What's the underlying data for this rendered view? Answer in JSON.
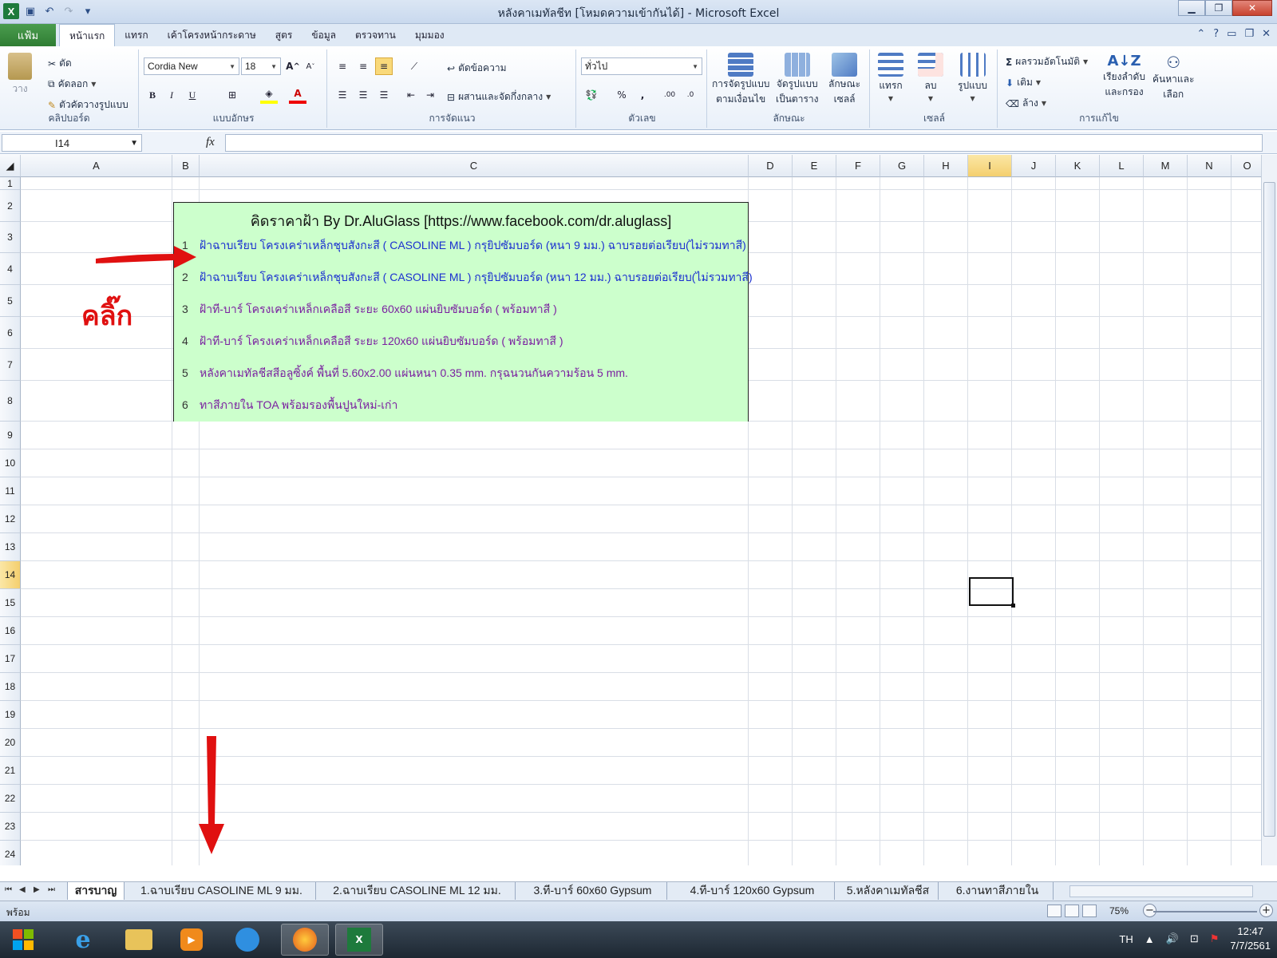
{
  "window": {
    "title": "หลังคาเมทัลชีท  [โหมดความเข้ากันได้] - Microsoft Excel"
  },
  "ribbon_tabs": {
    "file": "แฟ้ม",
    "tabs": [
      "หน้าแรก",
      "แทรก",
      "เค้าโครงหน้ากระดาษ",
      "สูตร",
      "ข้อมูล",
      "ตรวจทาน",
      "มุมมอง"
    ],
    "active": "หน้าแรก"
  },
  "ribbon": {
    "clipboard": {
      "paste": "วาง",
      "cut": "ตัด",
      "copy": "คัดลอก",
      "format_painter": "ตัวคัดวางรูปแบบ",
      "label": "คลิปบอร์ด"
    },
    "font": {
      "name": "Cordia New",
      "size": "18",
      "bold": "B",
      "italic": "I",
      "underline": "U",
      "label": "แบบอักษร"
    },
    "alignment": {
      "wrap": "ตัดข้อความ",
      "merge": "ผสานและจัดกึ่งกลาง",
      "label": "การจัดแนว"
    },
    "number": {
      "format": "ทั่วไป",
      "percent": "%",
      "comma": ",",
      "label": "ตัวเลข"
    },
    "styles": {
      "conditional": [
        "การจัดรูปแบบ",
        "ตามเงื่อนไข"
      ],
      "table": [
        "จัดรูปแบบ",
        "เป็นตาราง"
      ],
      "cell": [
        "ลักษณะ",
        "เซลล์"
      ],
      "label": "ลักษณะ"
    },
    "cells": {
      "insert": "แทรก",
      "delete": "ลบ",
      "format": "รูปแบบ",
      "label": "เซลล์"
    },
    "editing": {
      "autosum": "ผลรวมอัตโนมัติ",
      "fill": "เติม",
      "clear": "ล้าง",
      "sort": [
        "เรียงลำดับ",
        "และกรอง"
      ],
      "find": [
        "ค้นหาและ",
        "เลือก"
      ],
      "label": "การแก้ไข"
    }
  },
  "formula_bar": {
    "name_box": "I14",
    "fx": "fx",
    "content": ""
  },
  "columns": [
    "A",
    "B",
    "C",
    "D",
    "E",
    "F",
    "G",
    "H",
    "I",
    "J",
    "K",
    "L",
    "M",
    "N",
    "O"
  ],
  "selected_column": "I",
  "rows": [
    "1",
    "2",
    "3",
    "4",
    "5",
    "6",
    "7",
    "8",
    "9",
    "10",
    "11",
    "12",
    "13",
    "14",
    "15",
    "16",
    "17",
    "18",
    "19",
    "20",
    "21",
    "22",
    "23",
    "24"
  ],
  "selected_row": "14",
  "menu": {
    "title": "คิดราคาฝ้า By Dr.AluGlass [https://www.facebook.com/dr.aluglass]",
    "items": [
      {
        "num": "1",
        "text": "ฝ้าฉาบเรียบ โครงเคร่าเหล็กชุบสังกะสี ( CASOLINE ML )  กรุยิปซัมบอร์ด  (หนา 9 มม.) ฉาบรอยต่อเรียบ(ไม่รวมทาสี)",
        "color": "blue"
      },
      {
        "num": "2",
        "text": "ฝ้าฉาบเรียบ โครงเคร่าเหล็กชุบสังกะสี ( CASOLINE ML )  กรุยิปซัมบอร์ด  (หนา 12 มม.) ฉาบรอยต่อเรียบ(ไม่รวมทาสี)",
        "color": "blue"
      },
      {
        "num": "3",
        "text": "ฝ้าที-บาร์ โครงเคร่าเหล็กเคลือสี ระยะ 60x60 แผ่นยิบซัมบอร์ด ( พร้อมทาสี )",
        "color": "purple"
      },
      {
        "num": "4",
        "text": "ฝ้าที-บาร์ โครงเคร่าเหล็กเคลือสี ระยะ 120x60 แผ่นยิบซัมบอร์ด ( พร้อมทาสี )",
        "color": "purple"
      },
      {
        "num": "5",
        "text": "หลังคาเมทัลชีสสีอลูซิ้งค์ พื้นที่ 5.60x2.00 แผ่นหนา 0.35 mm. กรุฉนวนกันความร้อน 5 mm.",
        "color": "purple"
      },
      {
        "num": "6",
        "text": "ทาสีภายใน TOA พร้อมรองพื้นปูนใหม่-เก่า",
        "color": "purple"
      }
    ]
  },
  "annotation": {
    "click_text": "คลิ๊ก",
    "arrow_color": "#e01010"
  },
  "sheet_tabs": [
    "สารบาญ",
    "1.ฉาบเรียบ CASOLINE ML 9 มม.",
    "2.ฉาบเรียบ CASOLINE ML 12 มม.",
    "3.ที-บาร์ 60x60 Gypsum",
    "4.ที-บาร์ 120x60 Gypsum",
    "5.หลังคาเมทัลชีส",
    "6.งานทาสีภายใน"
  ],
  "active_sheet": "สารบาญ",
  "status": {
    "ready": "พร้อม",
    "zoom": "75%"
  },
  "taskbar": {
    "lang": "TH",
    "time": "12:47",
    "date": "7/7/2561"
  },
  "colors": {
    "menu_bg": "#ccffcc",
    "blue_text": "#1a2fd0",
    "purple_text": "#7a1fa0",
    "file_tab": "#2f7d33"
  }
}
